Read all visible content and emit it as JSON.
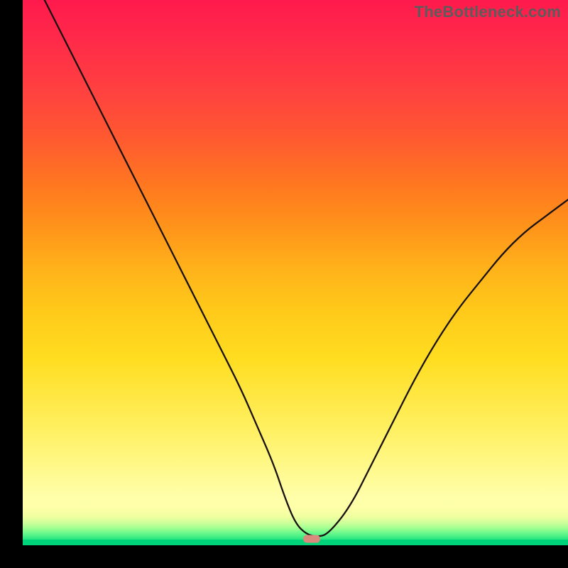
{
  "watermark": "TheBottleneck.com",
  "colors": {
    "gradient_top": "#ff1a4d",
    "gradient_mid": "#ffdd20",
    "gradient_low": "#ffffaa",
    "green": "#00d47a",
    "curve": "#1a1212",
    "marker": "#d98a7d",
    "background": "#000000"
  },
  "chart_data": {
    "type": "line",
    "title": "",
    "xlabel": "",
    "ylabel": "",
    "xlim": [
      0,
      100
    ],
    "ylim": [
      0,
      100
    ],
    "series": [
      {
        "name": "bottleneck-curve",
        "x": [
          4,
          8,
          12,
          16,
          20,
          24,
          28,
          32,
          36,
          40,
          43,
          46,
          48,
          50,
          52,
          54,
          56,
          60,
          64,
          68,
          72,
          76,
          80,
          84,
          88,
          92,
          96,
          100
        ],
        "y": [
          100,
          92,
          84,
          76,
          68,
          60,
          52,
          44,
          36,
          28,
          21,
          14,
          8,
          3,
          1,
          0.5,
          1,
          6,
          14,
          22,
          30,
          37,
          43,
          48,
          53,
          57,
          60,
          63
        ]
      }
    ],
    "marker": {
      "x": 53,
      "y": 0.2
    },
    "annotations": []
  }
}
